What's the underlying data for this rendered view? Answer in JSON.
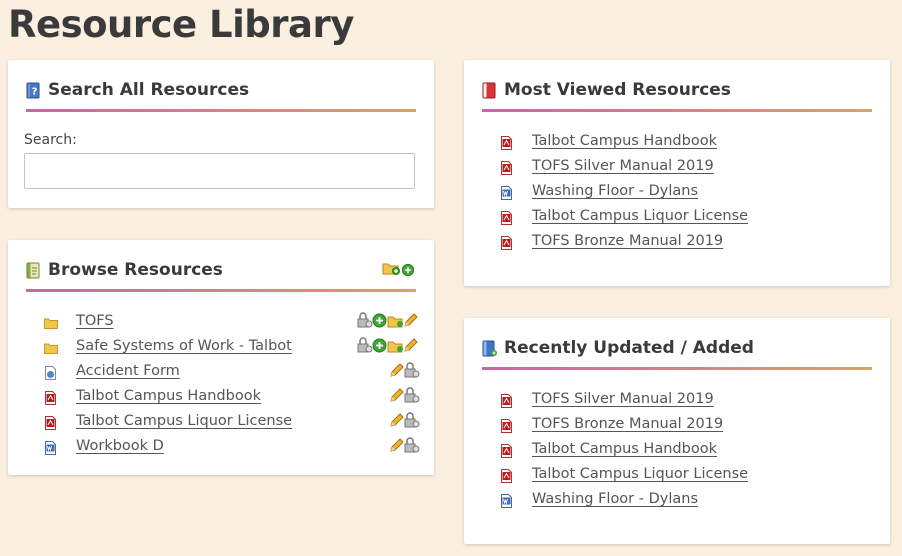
{
  "page": {
    "title": "Resource Library"
  },
  "search_panel": {
    "title": "Search All Resources",
    "icon": "help-book-icon",
    "search_label": "Search:",
    "search_value": ""
  },
  "browse_panel": {
    "title": "Browse Resources",
    "icon": "browse-book-icon",
    "header_actions": [
      "add-folder-icon",
      "add-resource-icon"
    ],
    "items": [
      {
        "label": "TOFS",
        "type": "folder",
        "actions": [
          "permissions-icon",
          "add-icon",
          "add-folder-icon",
          "edit-icon"
        ]
      },
      {
        "label": "Safe Systems of Work - Talbot",
        "type": "folder",
        "actions": [
          "permissions-icon",
          "add-icon",
          "add-folder-icon",
          "edit-icon"
        ]
      },
      {
        "label": "Accident Form",
        "type": "form",
        "actions": [
          "edit-icon",
          "permissions-icon"
        ]
      },
      {
        "label": "Talbot Campus Handbook",
        "type": "pdf",
        "actions": [
          "edit-icon",
          "permissions-icon"
        ]
      },
      {
        "label": "Talbot Campus Liquor License",
        "type": "pdf",
        "actions": [
          "edit-icon",
          "permissions-icon"
        ]
      },
      {
        "label": "Workbook D",
        "type": "word",
        "actions": [
          "edit-icon",
          "permissions-icon"
        ]
      }
    ]
  },
  "most_viewed_panel": {
    "title": "Most Viewed Resources",
    "icon": "book-icon",
    "items": [
      {
        "label": "Talbot Campus Handbook",
        "type": "pdf"
      },
      {
        "label": "TOFS Silver Manual 2019",
        "type": "pdf"
      },
      {
        "label": "Washing Floor - Dylans",
        "type": "word"
      },
      {
        "label": "Talbot Campus Liquor License",
        "type": "pdf"
      },
      {
        "label": "TOFS Bronze Manual 2019",
        "type": "pdf"
      }
    ]
  },
  "recent_panel": {
    "title": "Recently Updated / Added",
    "icon": "book-add-icon",
    "items": [
      {
        "label": "TOFS Silver Manual 2019",
        "type": "pdf"
      },
      {
        "label": "TOFS Bronze Manual 2019",
        "type": "pdf"
      },
      {
        "label": "Talbot Campus Handbook",
        "type": "pdf"
      },
      {
        "label": "Talbot Campus Liquor License",
        "type": "pdf"
      },
      {
        "label": "Washing Floor - Dylans",
        "type": "word"
      }
    ]
  },
  "colors": {
    "page_background": "#fbefe0",
    "underline_gradient_start": "#c865a6",
    "underline_gradient_end": "#d9a26b",
    "pdf_red": "#c0171c",
    "word_blue": "#3d68b3",
    "folder_yellow": "#f2c54b",
    "add_green": "#3fa535"
  }
}
